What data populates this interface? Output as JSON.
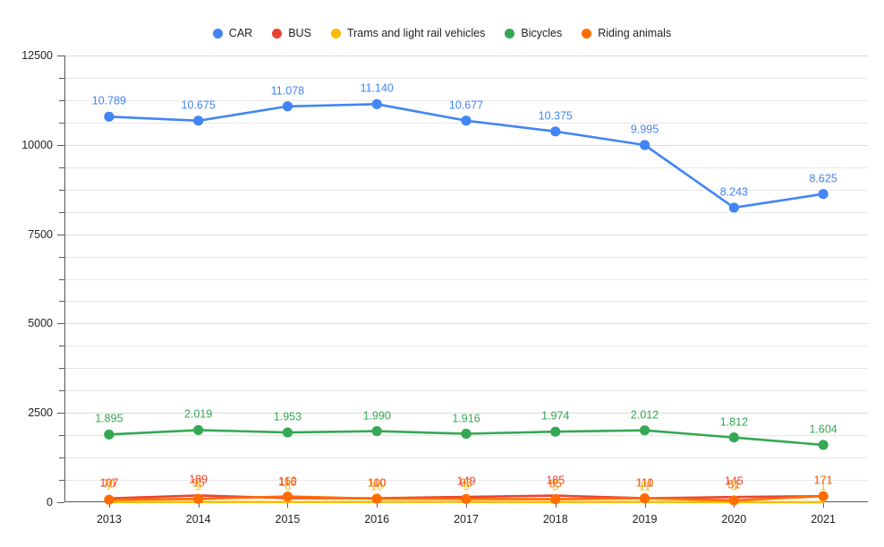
{
  "legend": {
    "position": "top",
    "items": [
      {
        "label": "CAR",
        "color": "#4285F4"
      },
      {
        "label": "BUS",
        "color": "#EA4335"
      },
      {
        "label": "Trams and light rail vehicles",
        "color": "#FBBC04"
      },
      {
        "label": "Bicycles",
        "color": "#34A853"
      },
      {
        "label": "Riding animals",
        "color": "#FF6D01"
      }
    ]
  },
  "axes": {
    "y_ticks": [
      "0",
      "2500",
      "5000",
      "7500",
      "10000",
      "12500"
    ],
    "x_ticks": [
      "2013",
      "2014",
      "2015",
      "2016",
      "2017",
      "2018",
      "2019",
      "2020",
      "2021"
    ]
  },
  "chart_data": {
    "type": "line",
    "title": "",
    "xlabel": "",
    "ylabel": "",
    "ylim": [
      0,
      12500
    ],
    "grid": true,
    "legend_position": "top",
    "categories": [
      "2013",
      "2014",
      "2015",
      "2016",
      "2017",
      "2018",
      "2019",
      "2020",
      "2021"
    ],
    "series": [
      {
        "name": "CAR",
        "color": "#4285F4",
        "values": [
          10789,
          10675,
          11078,
          11140,
          10677,
          10375,
          9995,
          8243,
          8625
        ],
        "labels": [
          "10.789",
          "10.675",
          "11.078",
          "11.140",
          "10.677",
          "10.375",
          "9.995",
          "8.243",
          "8.625"
        ]
      },
      {
        "name": "BUS",
        "color": "#EA4335",
        "values": [
          107,
          189,
          116,
          110,
          149,
          185,
          111,
          145,
          171
        ],
        "labels": [
          "107",
          "189",
          "116",
          "110",
          "149",
          "185",
          "111",
          "145",
          "171"
        ]
      },
      {
        "name": "Trams and light rail vehicles",
        "color": "#FBBC04",
        "values": [
          7,
          9,
          6,
          10,
          9,
          5,
          11,
          5,
          1
        ],
        "labels": [
          "7",
          "9",
          "6",
          "10",
          "9",
          "5",
          "11",
          "5",
          "1"
        ]
      },
      {
        "name": "Bicycles",
        "color": "#34A853",
        "values": [
          1895,
          2019,
          1953,
          1990,
          1916,
          1974,
          2012,
          1812,
          1604
        ],
        "labels": [
          "1.895",
          "2.019",
          "1.953",
          "1.990",
          "1.916",
          "1.974",
          "2.012",
          "1.812",
          "1.604"
        ]
      },
      {
        "name": "Riding animals",
        "color": "#FF6D01",
        "values": [
          70,
          95,
          160,
          100,
          93,
          85,
          110,
          51,
          171
        ],
        "labels": [
          "70",
          "95",
          "160",
          "100",
          "93",
          "85",
          "110",
          "51",
          "171"
        ]
      }
    ]
  }
}
